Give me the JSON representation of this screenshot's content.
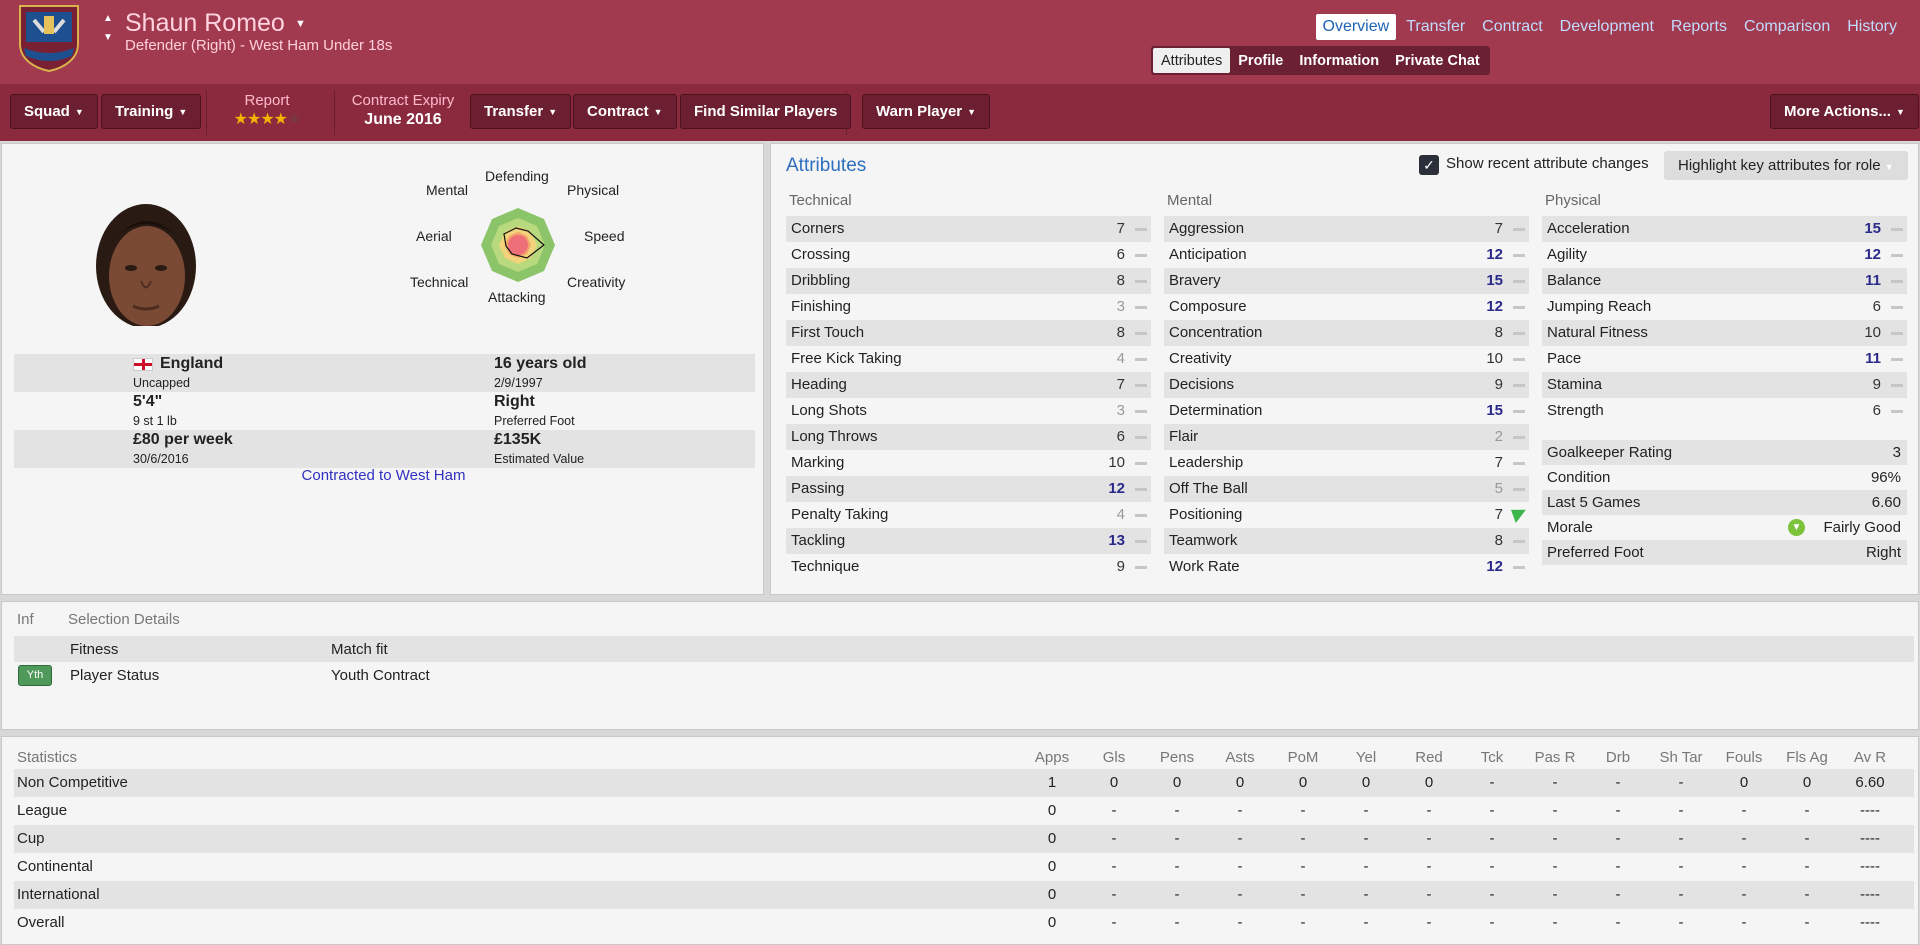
{
  "header": {
    "player_name": "Shaun Romeo",
    "position": "Defender (Right) - West Ham Under 18s",
    "crest_text": "WEST HAM UNITED",
    "tabs": [
      "Overview",
      "Transfer",
      "Contract",
      "Development",
      "Reports",
      "Comparison",
      "History"
    ],
    "active_tab": "Overview",
    "subtabs": [
      "Attributes",
      "Profile",
      "Information",
      "Private Chat"
    ],
    "active_subtab": "Attributes"
  },
  "toolbar": {
    "squad": "Squad",
    "training": "Training",
    "report_label": "Report",
    "report_stars": 4,
    "report_stars_max": 5,
    "contract_label": "Contract Expiry",
    "contract_value": "June 2016",
    "transfer": "Transfer",
    "contract": "Contract",
    "find_similar": "Find Similar Players",
    "warn_player": "Warn Player",
    "more_actions": "More Actions..."
  },
  "radar": {
    "labels": {
      "defending": "Defending",
      "physical": "Physical",
      "speed": "Speed",
      "creativity": "Creativity",
      "attacking": "Attacking",
      "technical": "Technical",
      "aerial": "Aerial",
      "mental": "Mental"
    }
  },
  "bio": {
    "nation": "England",
    "caps": "Uncapped",
    "age": "16 years old",
    "dob": "2/9/1997",
    "height": "5'4\"",
    "weight": "9 st 1 lb",
    "foot": "Right",
    "foot_label": "Preferred Foot",
    "wage": "£80 per week",
    "wage_date": "30/6/2016",
    "value": "£135K",
    "value_label": "Estimated Value",
    "contracted": "Contracted to West Ham"
  },
  "attributes": {
    "title": "Attributes",
    "show_changes_label": "Show recent attribute changes",
    "show_changes_checked": true,
    "highlight_button": "Highlight key attributes for role",
    "technical_title": "Technical",
    "mental_title": "Mental",
    "physical_title": "Physical",
    "technical": [
      {
        "name": "Corners",
        "value": "7"
      },
      {
        "name": "Crossing",
        "value": "6"
      },
      {
        "name": "Dribbling",
        "value": "8"
      },
      {
        "name": "Finishing",
        "value": "3"
      },
      {
        "name": "First Touch",
        "value": "8"
      },
      {
        "name": "Free Kick Taking",
        "value": "4"
      },
      {
        "name": "Heading",
        "value": "7"
      },
      {
        "name": "Long Shots",
        "value": "3"
      },
      {
        "name": "Long Throws",
        "value": "6"
      },
      {
        "name": "Marking",
        "value": "10"
      },
      {
        "name": "Passing",
        "value": "12"
      },
      {
        "name": "Penalty Taking",
        "value": "4"
      },
      {
        "name": "Tackling",
        "value": "13"
      },
      {
        "name": "Technique",
        "value": "9"
      }
    ],
    "mental": [
      {
        "name": "Aggression",
        "value": "7"
      },
      {
        "name": "Anticipation",
        "value": "12"
      },
      {
        "name": "Bravery",
        "value": "15"
      },
      {
        "name": "Composure",
        "value": "12"
      },
      {
        "name": "Concentration",
        "value": "8"
      },
      {
        "name": "Creativity",
        "value": "10"
      },
      {
        "name": "Decisions",
        "value": "9"
      },
      {
        "name": "Determination",
        "value": "15"
      },
      {
        "name": "Flair",
        "value": "2"
      },
      {
        "name": "Leadership",
        "value": "7"
      },
      {
        "name": "Off The Ball",
        "value": "5"
      },
      {
        "name": "Positioning",
        "value": "7",
        "trend": "up"
      },
      {
        "name": "Teamwork",
        "value": "8"
      },
      {
        "name": "Work Rate",
        "value": "12"
      }
    ],
    "physical": [
      {
        "name": "Acceleration",
        "value": "15"
      },
      {
        "name": "Agility",
        "value": "12"
      },
      {
        "name": "Balance",
        "value": "11"
      },
      {
        "name": "Jumping Reach",
        "value": "6"
      },
      {
        "name": "Natural Fitness",
        "value": "10"
      },
      {
        "name": "Pace",
        "value": "11"
      },
      {
        "name": "Stamina",
        "value": "9"
      },
      {
        "name": "Strength",
        "value": "6"
      }
    ],
    "summary": [
      {
        "name": "Goalkeeper Rating",
        "value": "3"
      },
      {
        "name": "Condition",
        "value": "96%"
      },
      {
        "name": "Last 5 Games",
        "value": "6.60"
      },
      {
        "name": "Morale",
        "value": "Fairly Good"
      },
      {
        "name": "Preferred Foot",
        "value": "Right"
      }
    ]
  },
  "selection": {
    "inf_header": "Inf",
    "title": "Selection Details",
    "rows": [
      {
        "badge": "",
        "label": "Fitness",
        "value": "Match fit"
      },
      {
        "badge": "Yth",
        "label": "Player Status",
        "value": "Youth Contract"
      }
    ]
  },
  "statistics": {
    "title": "Statistics",
    "columns": [
      "Apps",
      "Gls",
      "Pens",
      "Asts",
      "PoM",
      "Yel",
      "Red",
      "Tck",
      "Pas R",
      "Drb",
      "Sh Tar",
      "Fouls",
      "Fls Ag",
      "Av R"
    ],
    "rows": [
      {
        "name": "Non Competitive",
        "values": [
          "1",
          "0",
          "0",
          "0",
          "0",
          "0",
          "0",
          "-",
          "-",
          "-",
          "-",
          "0",
          "0",
          "6.60"
        ]
      },
      {
        "name": "League",
        "values": [
          "0",
          "-",
          "-",
          "-",
          "-",
          "-",
          "-",
          "-",
          "-",
          "-",
          "-",
          "-",
          "-",
          "----"
        ]
      },
      {
        "name": "Cup",
        "values": [
          "0",
          "-",
          "-",
          "-",
          "-",
          "-",
          "-",
          "-",
          "-",
          "-",
          "-",
          "-",
          "-",
          "----"
        ]
      },
      {
        "name": "Continental",
        "values": [
          "0",
          "-",
          "-",
          "-",
          "-",
          "-",
          "-",
          "-",
          "-",
          "-",
          "-",
          "-",
          "-",
          "----"
        ]
      },
      {
        "name": "International",
        "values": [
          "0",
          "-",
          "-",
          "-",
          "-",
          "-",
          "-",
          "-",
          "-",
          "-",
          "-",
          "-",
          "-",
          "----"
        ]
      },
      {
        "name": "Overall",
        "values": [
          "0",
          "-",
          "-",
          "-",
          "-",
          "-",
          "-",
          "-",
          "-",
          "-",
          "-",
          "-",
          "-",
          "----"
        ]
      }
    ]
  }
}
